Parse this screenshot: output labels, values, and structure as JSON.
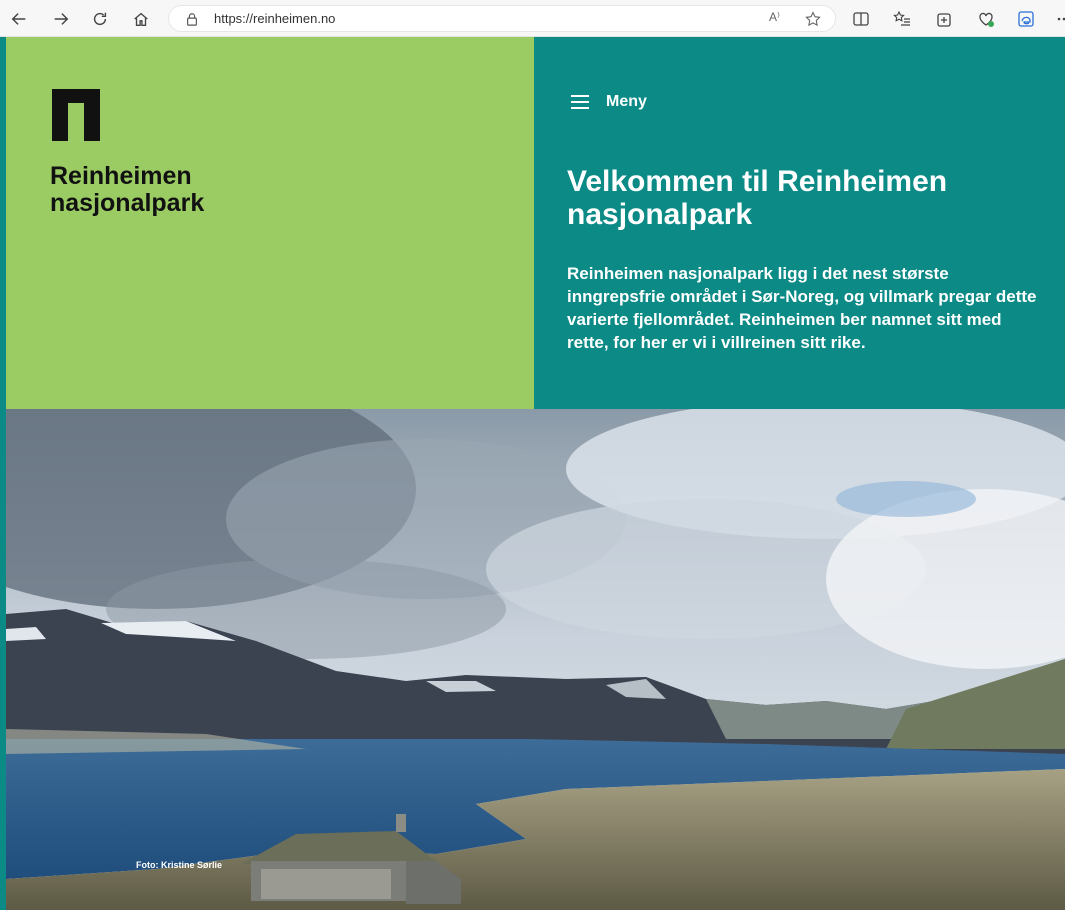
{
  "browser": {
    "url": "https://reinheimen.no",
    "read_aloud_label": "A⁾"
  },
  "brand": {
    "line1": "Reinheimen",
    "line2": "nasjonalpark"
  },
  "menu": {
    "label": "Meny"
  },
  "hero": {
    "title": "Velkommen til Reinheimen nasjonalpark",
    "lead": "Reinheimen nasjonalpark ligg i det nest største inngrepsfrie området i Sør-Noreg, og villmark pregar dette varierte fjellområdet. Reinheimen ber namnet sitt med rette, for her er vi i villreinen sitt rike."
  },
  "photo": {
    "credit": "Foto: Kristine Sørlie"
  },
  "colors": {
    "green_panel": "#9bcc64",
    "teal_panel": "#0b8a86"
  }
}
